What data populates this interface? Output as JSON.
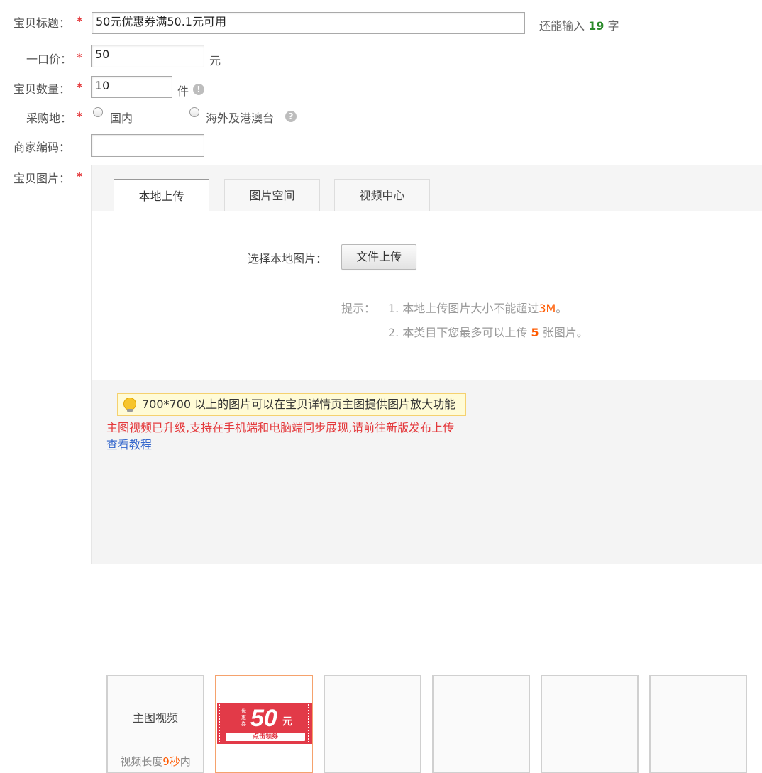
{
  "form": {
    "title_label": "宝贝标题：",
    "title_value": "50元优惠券满50.1元可用",
    "title_remaining_prefix": "还能输入",
    "title_remaining_count": "19",
    "title_remaining_suffix": "字",
    "price_label": "一口价：",
    "price_value": "50",
    "price_unit": "元",
    "quantity_label": "宝贝数量：",
    "quantity_value": "10",
    "quantity_unit": "件",
    "purchase_label": "采购地：",
    "purchase_options": [
      "国内",
      "海外及港澳台"
    ],
    "merchant_code_label": "商家编码：",
    "merchant_code_value": "",
    "images_label": "宝贝图片：",
    "required_mark": "*"
  },
  "upload": {
    "tabs": [
      "本地上传",
      "图片空间",
      "视频中心"
    ],
    "active_tab": 0,
    "choose_label": "选择本地图片：",
    "upload_button": "文件上传",
    "tips_label": "提示：",
    "tip1_prefix": "1. 本地上传图片大小不能超过",
    "tip1_size": "3M",
    "tip1_suffix": "。",
    "tip2_prefix": "2. 本类目下您最多可以上传",
    "tip2_count": "5",
    "tip2_suffix": "张图片。",
    "notice_text": "700*700 以上的图片可以在宝贝详情页主图提供图片放大功能",
    "warning_text": "主图视频已升级,支持在手机端和电脑端同步展现,请前往新版发布上传",
    "tutorial_link": "查看教程",
    "video_slot_label": "主图视频",
    "video_length_prefix": "视频长度",
    "video_length_value": "9秒",
    "video_length_suffix": "内",
    "coupon": {
      "side_text": "优惠券",
      "amount": "50",
      "currency": "元",
      "cta": "点击领券"
    }
  },
  "colors": {
    "required": "#e4393c",
    "counter_green": "#2a8a2a",
    "accent_orange": "#ff5a00",
    "link_blue": "#3366cc",
    "coupon_red": "#e23a48"
  },
  "icons": {
    "info": "info-icon",
    "help": "help-icon",
    "bulb": "lightbulb-icon"
  }
}
